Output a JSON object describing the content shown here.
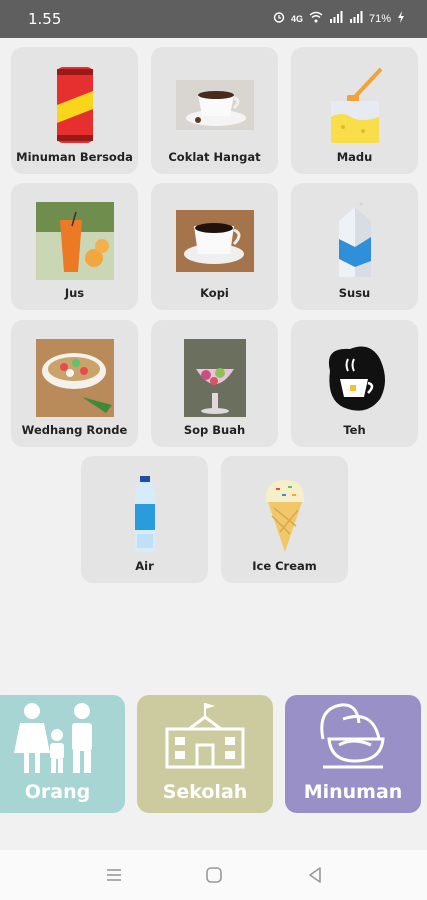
{
  "status": {
    "time": "1.55",
    "battery": "71%",
    "network": "4G"
  },
  "items": [
    {
      "label": "Minuman Bersoda"
    },
    {
      "label": "Coklat Hangat"
    },
    {
      "label": "Madu"
    },
    {
      "label": "Jus"
    },
    {
      "label": "Kopi"
    },
    {
      "label": "Susu"
    },
    {
      "label": "Wedhang Ronde"
    },
    {
      "label": "Sop Buah"
    },
    {
      "label": "Teh"
    },
    {
      "label": "Air"
    },
    {
      "label": "Ice Cream"
    }
  ],
  "categories": [
    {
      "label": "Orang",
      "color": "#a6d5d4"
    },
    {
      "label": "Sekolah",
      "color": "#cccb9f"
    },
    {
      "label": "Minuman",
      "color": "#9a90c8"
    }
  ]
}
